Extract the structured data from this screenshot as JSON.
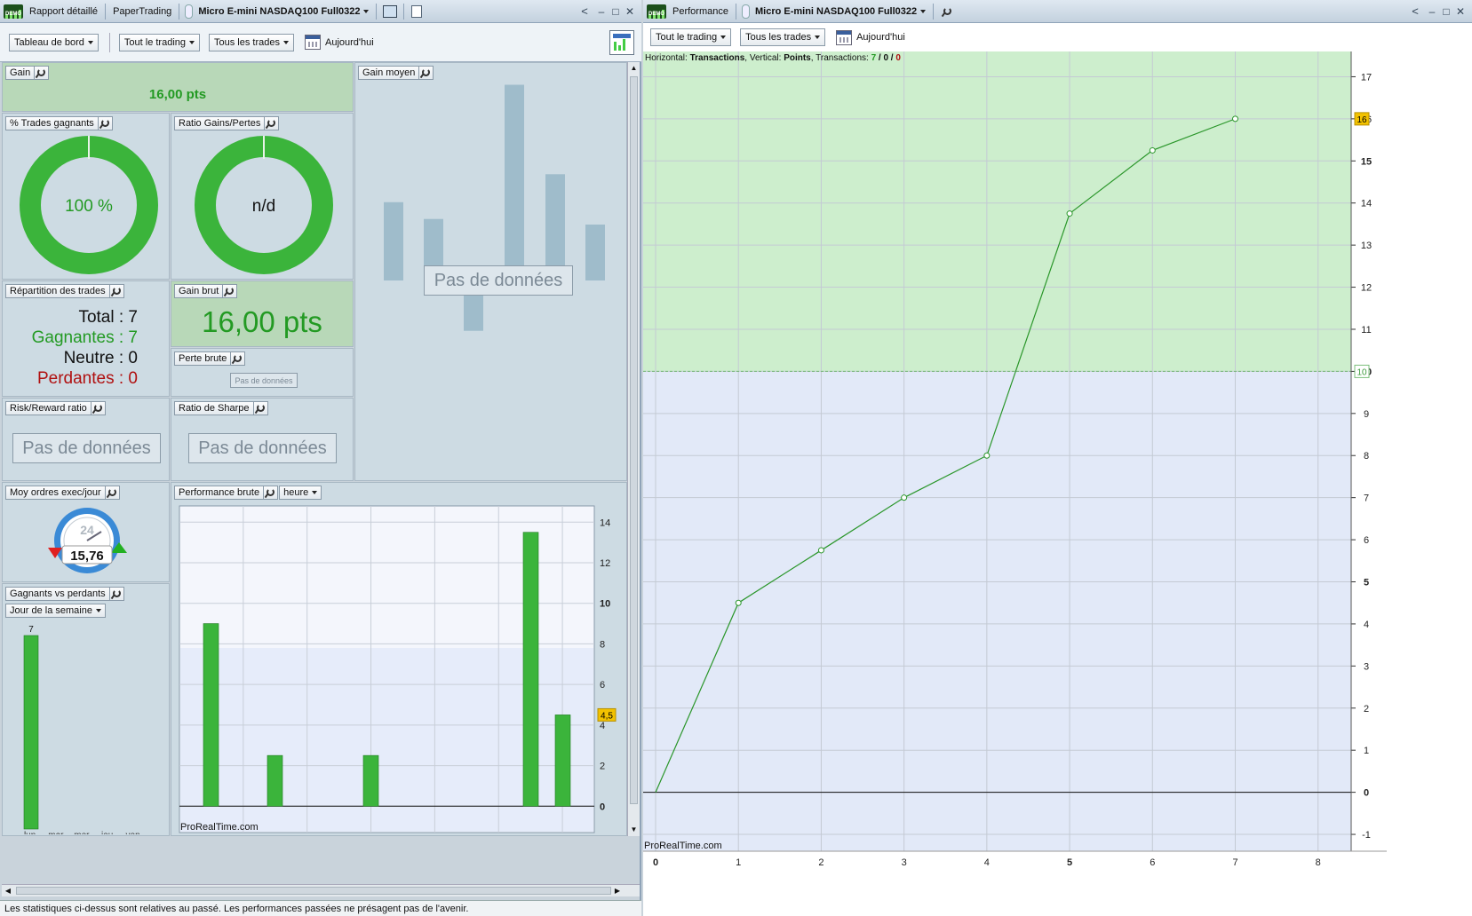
{
  "left_window": {
    "tabs": [
      "Rapport détaillé",
      "PaperTrading"
    ],
    "instrument": "Micro E-mini NASDAQ100 Full0322",
    "toolbar": {
      "dashboard": "Tableau de bord",
      "trading": "Tout le trading",
      "trades": "Tous les trades",
      "period": "Aujourd'hui"
    },
    "panels": {
      "gain": {
        "title": "Gain",
        "value": "16,00 pts"
      },
      "pct_winning": {
        "title": "% Trades gagnants",
        "value": "100 %",
        "fraction": 1.0
      },
      "ratio_gains_losses": {
        "title": "Ratio Gains/Pertes",
        "value": "n/d",
        "fraction": 1.0
      },
      "avg_gain": {
        "title": "Gain moyen",
        "nodata": "Pas de données"
      },
      "distribution": {
        "title": "Répartition des trades",
        "total": "Total : 7",
        "winners": "Gagnantes : 7",
        "neutral": "Neutre : 0",
        "losers": "Perdantes : 0"
      },
      "gross_gain": {
        "title": "Gain brut",
        "value": "16,00 pts"
      },
      "gross_loss": {
        "title": "Perte brute",
        "nodata": "Pas de données"
      },
      "risk_reward": {
        "title": "Risk/Reward ratio",
        "nodata": "Pas de données"
      },
      "sharpe": {
        "title": "Ratio de Sharpe",
        "nodata": "Pas de données"
      },
      "avg_orders": {
        "title": "Moy ordres exec/jour",
        "value": "15,76",
        "dial_label": "24"
      },
      "win_vs_loss": {
        "title": "Gagnants vs perdants",
        "selector": "Jour de la semaine",
        "bar_label": "7",
        "days": [
          "lun.",
          "mar.",
          "mer.",
          "jeu.",
          "ven."
        ]
      },
      "gross_perf": {
        "title": "Performance brute",
        "selector": "heure",
        "watermark": "ProRealTime.com",
        "last_value": "4,5"
      }
    },
    "disclaimer": "Les statistiques ci-dessus sont relatives au passé. Les performances passées ne présagent pas de l'avenir."
  },
  "right_window": {
    "tab": "Performance",
    "instrument": "Micro E-mini NASDAQ100 Full0322",
    "toolbar": {
      "trading": "Tout le trading",
      "trades": "Tous les trades",
      "period": "Aujourd'hui"
    },
    "legend": {
      "h_label": "Horizontal: ",
      "h_value": "Transactions",
      "v_label": ", Vertical: ",
      "v_value": "Points",
      "t_label": ", Transactions: ",
      "t_total": "7",
      "t_sep1": " / ",
      "t_mid": "0",
      "t_sep2": " / ",
      "t_last": "0"
    },
    "watermark": "ProRealTime.com",
    "threshold_label": "10",
    "last_value_label": "16"
  },
  "chart_data": [
    {
      "type": "line",
      "x": [
        0,
        1,
        2,
        3,
        4,
        5,
        6,
        7
      ],
      "y": [
        0,
        4.5,
        5.75,
        7,
        8,
        13.75,
        15.25,
        16
      ],
      "xlim": [
        0,
        8.4
      ],
      "ylim": [
        -1.4,
        17.6
      ],
      "x_ticks": [
        "0",
        "1",
        "2",
        "3",
        "4",
        "5",
        "6",
        "7",
        "8"
      ],
      "y_ticks": [
        "-1",
        "0",
        "1",
        "2",
        "3",
        "4",
        "5",
        "6",
        "7",
        "8",
        "9",
        "10",
        "11",
        "12",
        "13",
        "14",
        "15",
        "16",
        "17"
      ],
      "threshold": 10,
      "grid": true,
      "colors": {
        "above": "#cdeecd",
        "below": "#e2e9f8",
        "line": "#2a962a"
      }
    },
    {
      "type": "bar",
      "values": [
        9,
        2.5,
        2.5,
        13.5,
        4.5
      ],
      "ylim": [
        -1.3,
        14.8
      ],
      "y_ticks": [
        "0",
        "2",
        "4",
        "6",
        "8",
        "10",
        "12",
        "14"
      ],
      "grid": true,
      "colors": {
        "bar": "#3bb43b"
      }
    },
    {
      "type": "bar",
      "title": "Gain moyen",
      "values": [
        -1.4,
        -1.1,
        0.9,
        -3.5,
        -1.9,
        -1
      ],
      "colors": {
        "bar": "#9fbccb"
      }
    },
    {
      "type": "bar",
      "categories": [
        "lun.",
        "mar.",
        "mer.",
        "jeu.",
        "ven."
      ],
      "values": [
        7,
        0,
        0,
        0,
        0
      ],
      "colors": {
        "bar": "#3bb43b"
      }
    }
  ]
}
